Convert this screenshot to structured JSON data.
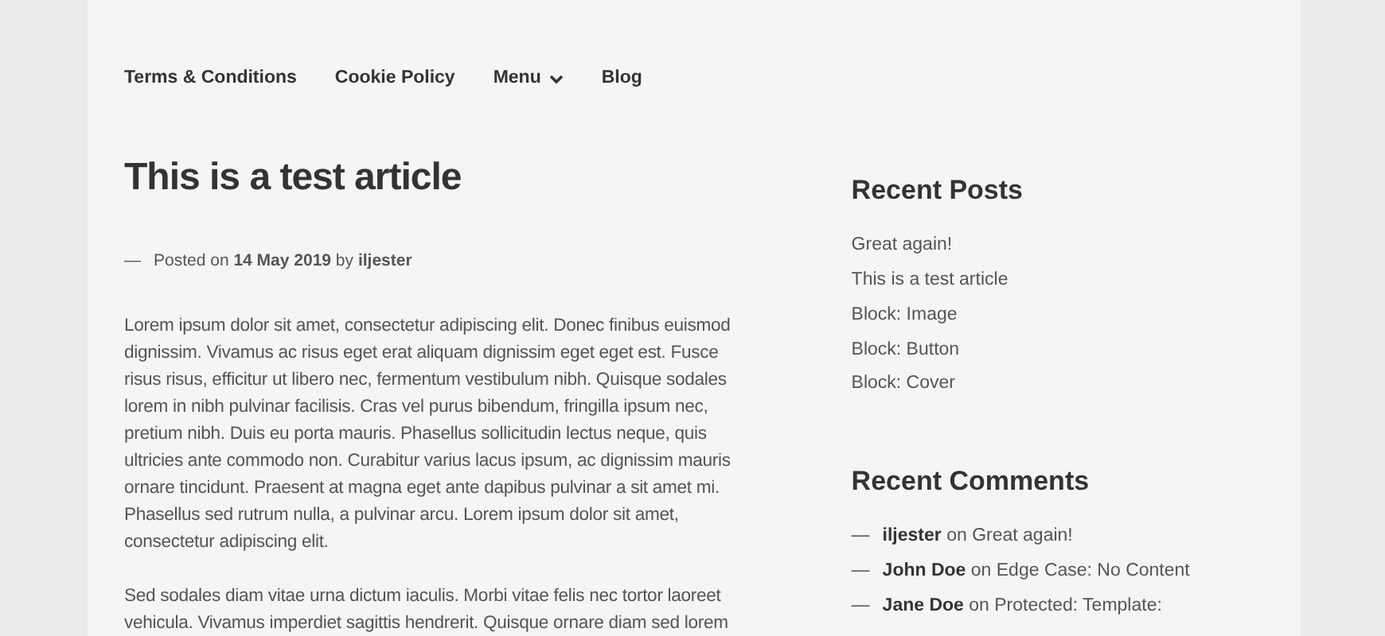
{
  "nav": [
    {
      "label": "Terms & Conditions",
      "kind": "link"
    },
    {
      "label": "Cookie Policy",
      "kind": "link"
    },
    {
      "label": "Menu",
      "kind": "dropdown"
    },
    {
      "label": "Blog",
      "kind": "link"
    }
  ],
  "article": {
    "title": "This is a test article",
    "dash": "—",
    "meta": "Posted on **14 May 2019** by **iljester**",
    "paragraphs": [
      "Lorem ipsum dolor sit amet, consectetur adipiscing elit. Donec finibus euismod dignissim. Vivamus ac risus eget erat aliquam dignissim eget eget est. Fusce risus risus, efficitur ut libero nec, fermentum vestibulum nibh. Quisque sodales lorem in nibh pulvinar facilisis. Cras vel purus bibendum, fringilla ipsum nec, pretium nibh. Duis eu porta mauris. Phasellus sollicitudin lectus neque, quis ultricies ante commodo non. Curabitur varius lacus ipsum, ac dignissim mauris ornare tincidunt. Praesent at magna eget ante dapibus pulvinar a sit amet mi. Phasellus sed rutrum nulla, a pulvinar arcu. Lorem ipsum dolor sit amet, consectetur adipiscing elit.",
      "Sed sodales diam vitae urna dictum iaculis. Morbi vitae felis nec tortor laoreet vehicula. Vivamus imperdiet sagittis hendrerit. Quisque ornare diam sed lorem"
    ]
  },
  "recent_posts": {
    "title": "Recent Posts",
    "items": [
      "Great again!",
      "This is a test article",
      "Block: Image",
      "Block: Button",
      "Block: Cover"
    ]
  },
  "recent_comments": {
    "title": "Recent Comments",
    "items": [
      {
        "dash": "—",
        "author": "iljester",
        "on": "on",
        "post": "Great again!"
      },
      {
        "dash": "—",
        "author": "John Doe",
        "on": "on",
        "post": "Edge Case: No Content"
      },
      {
        "dash": "—",
        "author": "Jane Doe",
        "on": "on",
        "post": "Protected: Template:"
      }
    ]
  }
}
